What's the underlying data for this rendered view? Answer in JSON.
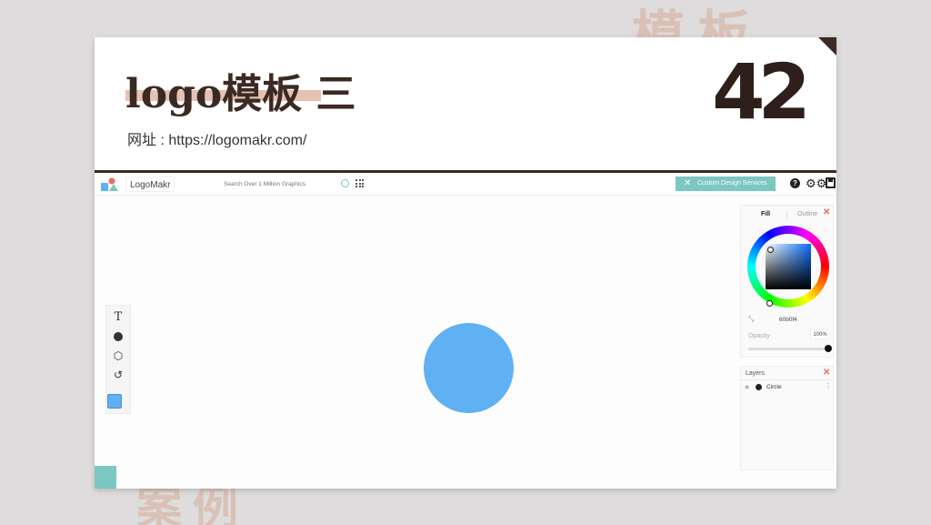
{
  "slide": {
    "title": "logo模板 三",
    "subtitle": "网址 : https://logomakr.com/",
    "number": "42",
    "watermark_top": "模板",
    "watermark_bottom": "案例"
  },
  "app": {
    "brand": "LogoMakr",
    "search_placeholder": "Search Over 1 Million Graphics",
    "custom_design_label": "Custom Design Services",
    "help_label": "?",
    "gear_glyph": "⚙⚙"
  },
  "tools": [
    {
      "name": "text-tool",
      "glyph": "T"
    },
    {
      "name": "shape-tool",
      "glyph": "●"
    },
    {
      "name": "graphic-tool",
      "glyph": "⬡"
    },
    {
      "name": "history-tool",
      "glyph": "↺"
    }
  ],
  "canvas": {
    "shape": "circle",
    "fill_color": "#60b0f4"
  },
  "color_panel": {
    "tab_fill": "Fill",
    "tab_outline": "Outline",
    "hex_value": "60b0f4",
    "opacity_label": "Opacity",
    "opacity_value": "100%",
    "opacity_level": 1.0
  },
  "layers_panel": {
    "title": "Layers",
    "items": [
      {
        "name": "Circle"
      }
    ]
  },
  "colors": {
    "accent_teal": "#7cc7c1",
    "brand_dark": "#3b2a23",
    "highlight": "#e6c2b3",
    "close_red": "#e8705c"
  }
}
